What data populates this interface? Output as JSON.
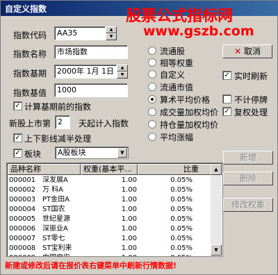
{
  "window": {
    "title": "自定义指数"
  },
  "watermark": {
    "line1": "股票公式指标网",
    "line2": "www.gszb.com"
  },
  "form": {
    "code_label": "指数代码",
    "code_value": "AA35",
    "name_label": "指数名称",
    "name_value": "市场指数",
    "base_date_label": "指数基期",
    "base_date_value": "2000年 1月 1日",
    "base_value_label": "指数基值",
    "base_value_value": "1000",
    "calc_before_base_label": "计算基期前的指数",
    "new_stock_prefix": "新股上市第",
    "new_stock_days": "2",
    "new_stock_suffix": "天起计入指数",
    "shadow_half_label": "上下影线减半处理",
    "sector_label": "板块",
    "sector_value": "A股板块"
  },
  "weight_options": [
    "流通股",
    "相等权重",
    "自定义"
  ],
  "price_options": [
    "流通市值",
    "算术平均价格",
    "成交量加权均价",
    "持仓量加权均价",
    "平均涨幅"
  ],
  "price_selected": 1,
  "buttons": {
    "cancel": "取消",
    "new": "新增",
    "delete": "删除",
    "modify_weight": "修改权重"
  },
  "icons": {
    "cancel": "x-icon"
  },
  "options": {
    "realtime": "实时刷新",
    "no_suspend": "不计停牌",
    "adjust": "复权处理"
  },
  "table": {
    "headers": [
      "品种名称",
      "权重(基本平...",
      "比重"
    ],
    "rows": [
      {
        "code": "000001",
        "name": "深发展A",
        "weight": "1.00",
        "ratio": "0.05%"
      },
      {
        "code": "000002",
        "name": "万  科A",
        "weight": "1.00",
        "ratio": "0.05%"
      },
      {
        "code": "000003",
        "name": "PT金田A",
        "weight": "1.00",
        "ratio": "0.05%"
      },
      {
        "code": "000004",
        "name": "ST国农",
        "weight": "1.00",
        "ratio": "0.05%"
      },
      {
        "code": "000005",
        "name": "世纪星源",
        "weight": "1.00",
        "ratio": "0.05%"
      },
      {
        "code": "000006",
        "name": "深振业A",
        "weight": "1.00",
        "ratio": "0.05%"
      },
      {
        "code": "000007",
        "name": "ST零七",
        "weight": "1.00",
        "ratio": "0.05%"
      },
      {
        "code": "000008",
        "name": "ST宝利来",
        "weight": "1.00",
        "ratio": "0.05%"
      },
      {
        "code": "000009",
        "name": "中国宝安",
        "weight": "1.00",
        "ratio": "0.05%"
      }
    ]
  },
  "footer": {
    "note": "新建或修改后请在报价表右键菜单中刷新行情数据!"
  }
}
